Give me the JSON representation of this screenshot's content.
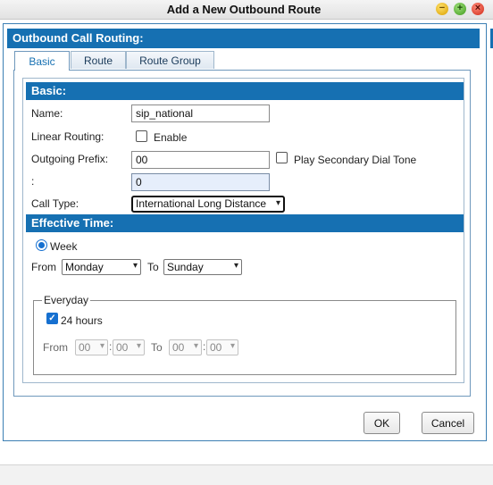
{
  "window": {
    "title": "Add a New Outbound Route",
    "min_glyph": "−",
    "max_glyph": "+",
    "close_glyph": "×"
  },
  "section": {
    "title": "Outbound Call Routing:"
  },
  "tabs": [
    {
      "label": "Basic",
      "active": true
    },
    {
      "label": "Route",
      "active": false
    },
    {
      "label": "Route Group",
      "active": false
    }
  ],
  "basic": {
    "header": "Basic:",
    "name_label": "Name:",
    "name_value": "sip_national",
    "linear_label": "Linear Routing:",
    "linear_checked": false,
    "linear_option": "Enable",
    "prefix_label": "Outgoing Prefix:",
    "prefix_value": "00",
    "secondary_tone_checked": false,
    "secondary_tone_label": "Play Secondary Dial Tone",
    "colon_label": ":",
    "colon_value": "0",
    "call_type_label": "Call Type:",
    "call_type_value": "International Long Distance"
  },
  "effective": {
    "header": "Effective Time:",
    "week_label": "Week",
    "week_selected": true,
    "from_label": "From",
    "from_value": "Monday",
    "to_label": "To",
    "to_value": "Sunday",
    "everyday_legend": "Everyday",
    "all_day_checked": true,
    "all_day_label": "24 hours",
    "time_from_label": "From",
    "time_from_hour": "00",
    "time_from_min": "00",
    "time_sep": ":",
    "time_to_label": "To",
    "time_to_hour": "00",
    "time_to_min": "00"
  },
  "buttons": {
    "ok": "OK",
    "cancel": "Cancel"
  },
  "icons": {
    "dropdown": "▾",
    "check": "✓"
  },
  "colors": {
    "accent": "#1670b2",
    "checkbox": "#1670d0"
  }
}
